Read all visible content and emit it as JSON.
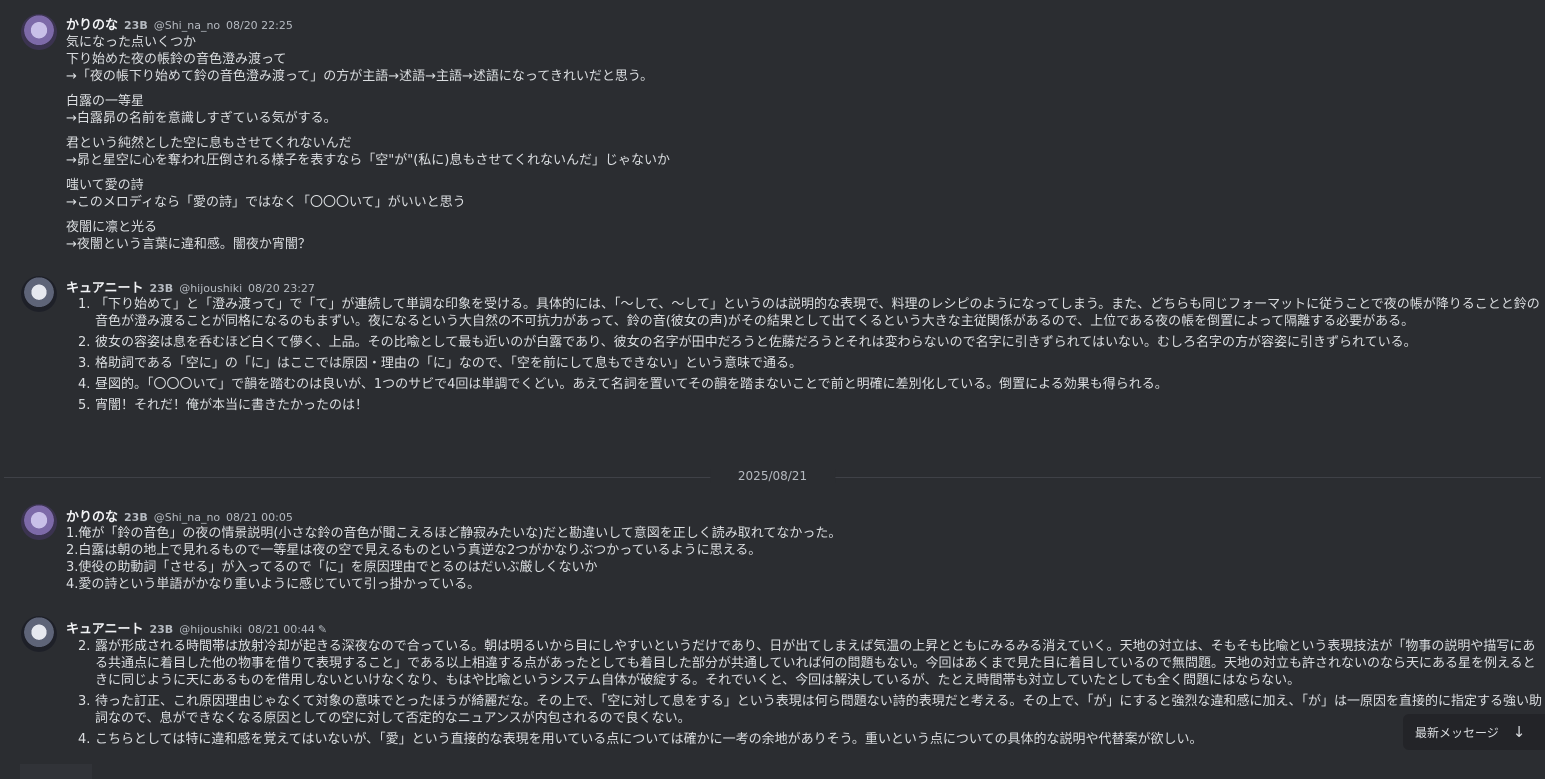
{
  "messages": [
    {
      "author": "かりのな",
      "tag": "23B",
      "handle": "@Shi_na_no",
      "time": "08/20 22:25",
      "paragraphs": [
        [
          "気になった点いくつか",
          "下り始めた夜の帳鈴の音色澄み渡って",
          "→「夜の帳下り始めて鈴の音色澄み渡って」の方が主語→述語→主語→述語になってきれいだと思う。"
        ],
        [
          "白露の一等星",
          "→白露昴の名前を意識しすぎている気がする。"
        ],
        [
          "君という純然とした空に息もさせてくれないんだ",
          "→昴と星空に心を奪われ圧倒される様子を表すなら「空\"が\"(私に)息もさせてくれないんだ」じゃないか"
        ],
        [
          "嗤いて愛の詩",
          "→このメロディなら「愛の詩」ではなく「〇〇〇いて」がいいと思う"
        ],
        [
          "夜闇に凛と光る",
          "→夜闇という言葉に違和感。闇夜か宵闇？"
        ]
      ]
    },
    {
      "author": "キュアニート",
      "tag": "23B",
      "handle": "@hijoushiki",
      "time": "08/20 23:27",
      "items": [
        {
          "num": "1.",
          "text": "「下り始めて」と「澄み渡って」で「て」が連続して単調な印象を受ける。具体的には、「〜して、〜して」というのは説明的な表現で、料理のレシピのようになってしまう。また、どちらも同じフォーマットに従うことで夜の帳が降りることと鈴の音色が澄み渡ることが同格になるのもまずい。夜になるという大自然の不可抗力があって、鈴の音(彼女の声)がその結果として出てくるという大きな主従関係があるので、上位である夜の帳を倒置によって隔離する必要がある。"
        },
        {
          "num": "2.",
          "text": "彼女の容姿は息を呑むほど白くて儚く、上品。その比喩として最も近いのが白露であり、彼女の名字が田中だろうと佐藤だろうとそれは変わらないので名字に引きずられてはいない。むしろ名字の方が容姿に引きずられている。"
        },
        {
          "num": "3.",
          "text": "格助詞である「空に」の「に」はここでは原因・理由の「に」なので、「空を前にして息もできない」という意味で通る。"
        },
        {
          "num": "4.",
          "text": "昼図的。「〇〇〇いて」で韻を踏むのは良いが、1つのサビで4回は単調でくどい。あえて名詞を置いてその韻を踏まないことで前と明確に差別化している。倒置による効果も得られる。"
        },
        {
          "num": "5.",
          "text": "宵闇！それだ！俺が本当に書きたかったのは！"
        }
      ]
    },
    {
      "author": "かりのな",
      "tag": "23B",
      "handle": "@Shi_na_no",
      "time": "08/21 00:05",
      "lines": [
        "1.俺が「鈴の音色」の夜の情景説明(小さな鈴の音色が聞こえるほど静寂みたいな)だと勘違いして意図を正しく読み取れてなかった。",
        "2.白露は朝の地上で見れるもので一等星は夜の空で見えるものという真逆な2つがかなりぶつかっているように思える。",
        "3.使役の助動詞「させる」が入ってるので「に」を原因理由でとるのはだいぶ厳しくないか",
        "4.愛の詩という単語がかなり重いように感じていて引っ掛かっている。"
      ]
    },
    {
      "author": "キュアニート",
      "tag": "23B",
      "handle": "@hijoushiki",
      "time": "08/21 00:44",
      "items": [
        {
          "num": "2.",
          "text": "露が形成される時間帯は放射冷却が起きる深夜なので合っている。朝は明るいから目にしやすいというだけであり、日が出てしまえば気温の上昇とともにみるみる消えていく。天地の対立は、そもそも比喩という表現技法が「物事の説明や描写にある共通点に着目した他の物事を借りて表現すること」である以上相違する点があったとしても着目した部分が共通していれば何の問題もない。今回はあくまで見た目に着目しているので無問題。天地の対立も許されないのなら天にある星を例えるときに同じように天にあるものを借用しないといけなくなり、もはや比喩というシステム自体が破綻する。それでいくと、今回は解決しているが、たとえ時間帯も対立していたとしても全く問題にはならない。"
        },
        {
          "num": "3.",
          "text": "待った訂正、これ原因理由じゃなくて対象の意味でとったほうが綺麗だな。その上で、「空に対して息をする」という表現は何ら問題ない詩的表現だと考える。その上で、「が」にすると強烈な違和感に加え、「が」は一原因を直接的に指定する強い助詞なので、息ができなくなる原因としての空に対して否定的なニュアンスが内包されるので良くない。"
        },
        {
          "num": "4.",
          "text": "こちらとしては特に違和感を覚えてはいないが、「愛」という直接的な表現を用いている点については確かに一考の余地がありそう。重いという点についての具体的な説明や代替案が欲しい。"
        }
      ]
    }
  ],
  "divider": {
    "date": "2025/08/21"
  },
  "jump_button": {
    "label": "最新メッセージ",
    "icon": "arrow-down-icon"
  },
  "colors": {
    "background": "#2b2d31",
    "text": "#dbdee1",
    "username": "#f2f3f5",
    "muted": "#b5bac1"
  }
}
